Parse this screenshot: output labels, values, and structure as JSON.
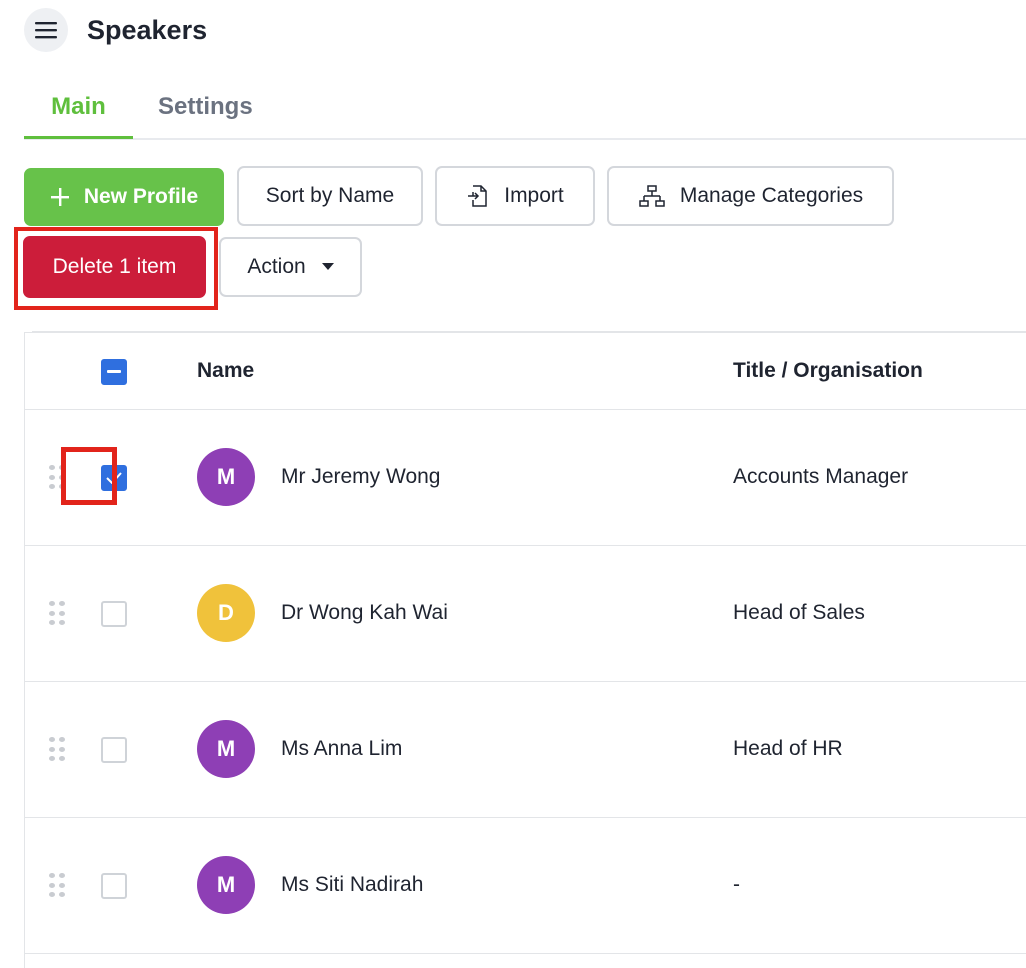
{
  "header": {
    "title": "Speakers",
    "menu_icon": "hamburger-menu-icon"
  },
  "tabs": [
    {
      "label": "Main",
      "active": true
    },
    {
      "label": "Settings",
      "active": false
    }
  ],
  "toolbar": {
    "new_profile": "New Profile",
    "sort_by_name": "Sort by Name",
    "import": "Import",
    "manage_categories": "Manage Categories",
    "delete": "Delete 1 item",
    "action": "Action"
  },
  "table": {
    "columns": {
      "name": "Name",
      "title": "Title / Organisation"
    },
    "rows": [
      {
        "initial": "M",
        "avatar_color": "#8e3fb5",
        "name": "Mr Jeremy Wong",
        "title": "Accounts Manager",
        "checked": true
      },
      {
        "initial": "D",
        "avatar_color": "#f0c23b",
        "name": "Dr Wong Kah Wai",
        "title": "Head of Sales",
        "checked": false
      },
      {
        "initial": "M",
        "avatar_color": "#8e3fb5",
        "name": "Ms Anna Lim",
        "title": "Head of HR",
        "checked": false
      },
      {
        "initial": "M",
        "avatar_color": "#8e3fb5",
        "name": "Ms Siti Nadirah",
        "title": "-",
        "checked": false
      }
    ]
  },
  "colors": {
    "accent_green": "#5fbf3d",
    "delete_red": "#cc1d3a",
    "checkbox_blue": "#2f6fdf",
    "highlight_red": "#e2241b"
  }
}
